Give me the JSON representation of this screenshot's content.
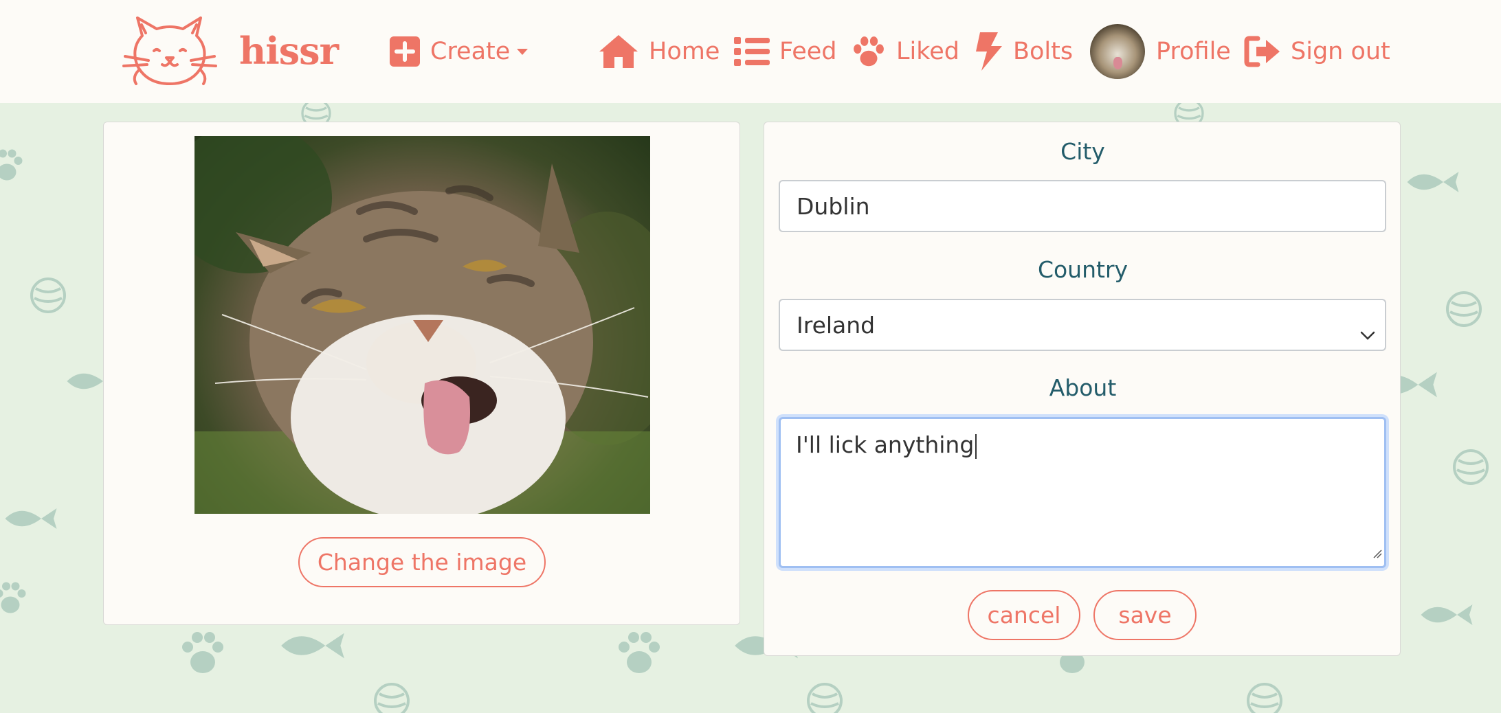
{
  "brand": {
    "name": "hissr",
    "logo_icon": "cat-face-icon"
  },
  "nav": {
    "create": {
      "label": "Create",
      "icon": "plus-square-icon"
    },
    "home": {
      "label": "Home",
      "icon": "house-icon"
    },
    "feed": {
      "label": "Feed",
      "icon": "list-icon"
    },
    "liked": {
      "label": "Liked",
      "icon": "paw-icon"
    },
    "bolts": {
      "label": "Bolts",
      "icon": "bolt-icon"
    },
    "profile": {
      "label": "Profile",
      "icon": "avatar"
    },
    "signout": {
      "label": "Sign out",
      "icon": "sign-out-icon"
    }
  },
  "image_panel": {
    "change_label": "Change the image"
  },
  "form": {
    "city": {
      "label": "City",
      "value": "Dublin"
    },
    "country": {
      "label": "Country",
      "value": "Ireland"
    },
    "about": {
      "label": "About",
      "value": "I'll lick anything"
    },
    "cancel_label": "cancel",
    "save_label": "save"
  },
  "colors": {
    "accent": "#ee7566",
    "label": "#235c6a",
    "page_bg": "#e6f1e2",
    "navbar_bg": "#fdfbf7",
    "focus_ring": "#9fbff2"
  }
}
